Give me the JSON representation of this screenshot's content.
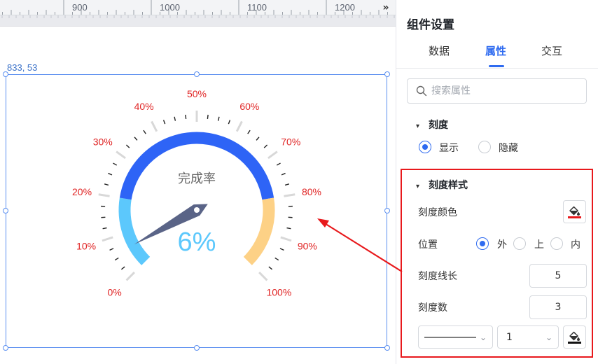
{
  "ruler": {
    "labels": [
      "900",
      "1000",
      "1100",
      "1200"
    ],
    "more_icon": "double-chevron-right-icon",
    "more_glyph": "»"
  },
  "selection": {
    "coords": "833, 53"
  },
  "gauge": {
    "title": "完成率",
    "value_text": "6%",
    "value_fraction": 0.06,
    "tick_labels": [
      "0%",
      "10%",
      "20%",
      "30%",
      "40%",
      "50%",
      "60%",
      "70%",
      "80%",
      "90%",
      "100%"
    ],
    "colors": {
      "segment_low": "#5cc8fc",
      "segment_mid": "#2e64f6",
      "segment_high": "#fdd186",
      "pointer": "#5a6487",
      "tick_label": "#e02424",
      "value_text": "#5cc8fc",
      "title_text": "#666666"
    }
  },
  "panel": {
    "title": "组件设置",
    "tabs": [
      {
        "label": "数据",
        "active": false
      },
      {
        "label": "属性",
        "active": true
      },
      {
        "label": "交互",
        "active": false
      }
    ],
    "search": {
      "placeholder": "搜索属性",
      "value": ""
    },
    "scale_section": {
      "title": "刻度",
      "options": [
        {
          "label": "显示",
          "selected": true
        },
        {
          "label": "隐藏",
          "selected": false
        }
      ]
    },
    "scale_style_section": {
      "title": "刻度样式",
      "color_label": "刻度颜色",
      "color_value": "#e8191c",
      "position_label": "位置",
      "position_options": [
        {
          "label": "外",
          "selected": true
        },
        {
          "label": "上",
          "selected": false
        },
        {
          "label": "内",
          "selected": false
        }
      ],
      "line_length_label": "刻度线长",
      "line_length_value": "5",
      "count_label": "刻度数",
      "count_value": "3",
      "line_style": "solid",
      "line_width_value": "1",
      "line_color_value": "#111111"
    }
  },
  "annotation": {
    "highlight_color": "#e8191c"
  }
}
